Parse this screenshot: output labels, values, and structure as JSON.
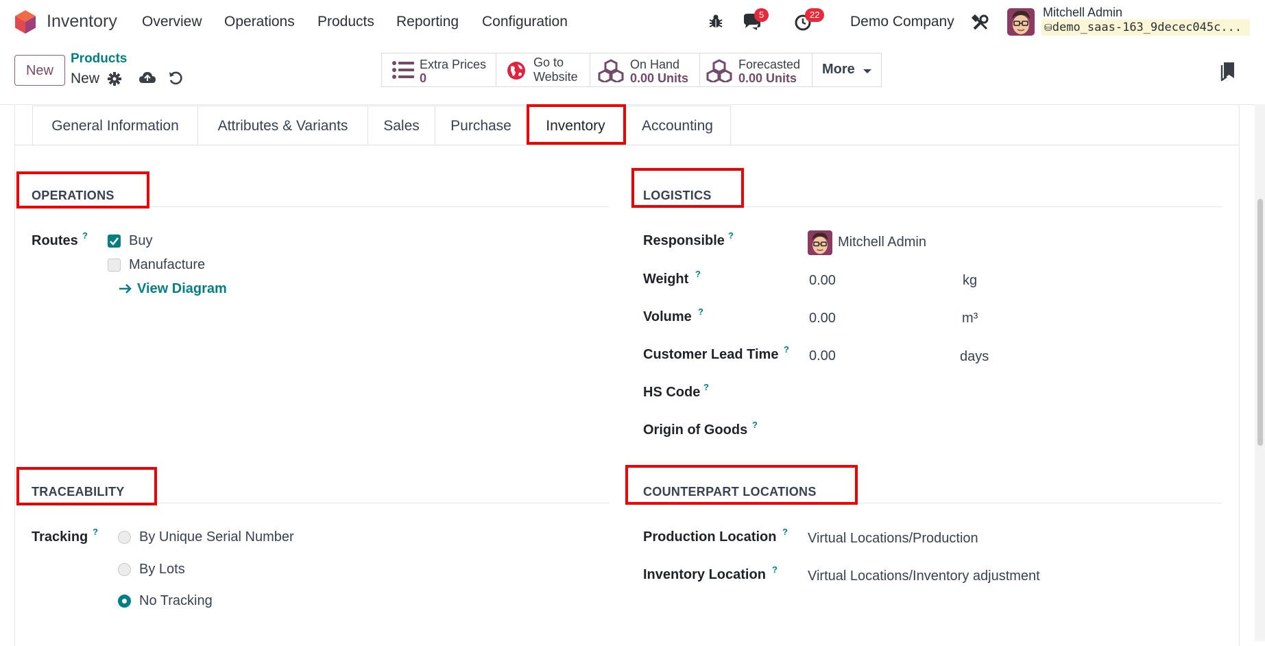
{
  "navbar": {
    "app_name": "Inventory",
    "menu": [
      "Overview",
      "Operations",
      "Products",
      "Reporting",
      "Configuration"
    ],
    "messages_count": "5",
    "activities_count": "22",
    "company": "Demo Company",
    "user_name": "Mitchell Admin",
    "database": "demo_saas-163_9decec045c..."
  },
  "control_panel": {
    "new_label": "New",
    "breadcrumb_parent": "Products",
    "breadcrumb_current": "New",
    "smart_buttons": {
      "extra_prices": {
        "label": "Extra Prices",
        "value": "0"
      },
      "website": {
        "label_1": "Go to",
        "label_2": "Website"
      },
      "on_hand": {
        "label": "On Hand",
        "value": "0.00 Units"
      },
      "forecasted": {
        "label": "Forecasted",
        "value": "0.00 Units"
      },
      "more": "More"
    }
  },
  "tabs": [
    "General Information",
    "Attributes & Variants",
    "Sales",
    "Purchase",
    "Inventory",
    "Accounting"
  ],
  "active_tab": "Inventory",
  "operations": {
    "title": "OPERATIONS",
    "routes_label": "Routes",
    "routes": [
      {
        "label": "Buy",
        "checked": true
      },
      {
        "label": "Manufacture",
        "checked": false
      }
    ],
    "view_diagram": "View Diagram"
  },
  "logistics": {
    "title": "LOGISTICS",
    "responsible_label": "Responsible",
    "responsible": "Mitchell Admin",
    "weight_label": "Weight",
    "weight": "0.00",
    "weight_unit": "kg",
    "volume_label": "Volume",
    "volume": "0.00",
    "volume_unit": "m³",
    "lead_time_label": "Customer Lead Time",
    "lead_time": "0.00",
    "lead_time_unit": "days",
    "hs_code_label": "HS Code",
    "origin_label": "Origin of Goods"
  },
  "traceability": {
    "title": "TRACEABILITY",
    "tracking_label": "Tracking",
    "options": [
      {
        "label": "By Unique Serial Number",
        "selected": false
      },
      {
        "label": "By Lots",
        "selected": false
      },
      {
        "label": "No Tracking",
        "selected": true
      }
    ]
  },
  "counterpart": {
    "title": "COUNTERPART LOCATIONS",
    "production_label": "Production Location",
    "production": "Virtual Locations/Production",
    "inventory_label": "Inventory Location",
    "inventory": "Virtual Locations/Inventory adjustment"
  },
  "help_mark": "?",
  "colors": {
    "brand": "#714b67",
    "accent": "#017e84",
    "highlight": "#ee0000",
    "badge": "#e8293a"
  }
}
